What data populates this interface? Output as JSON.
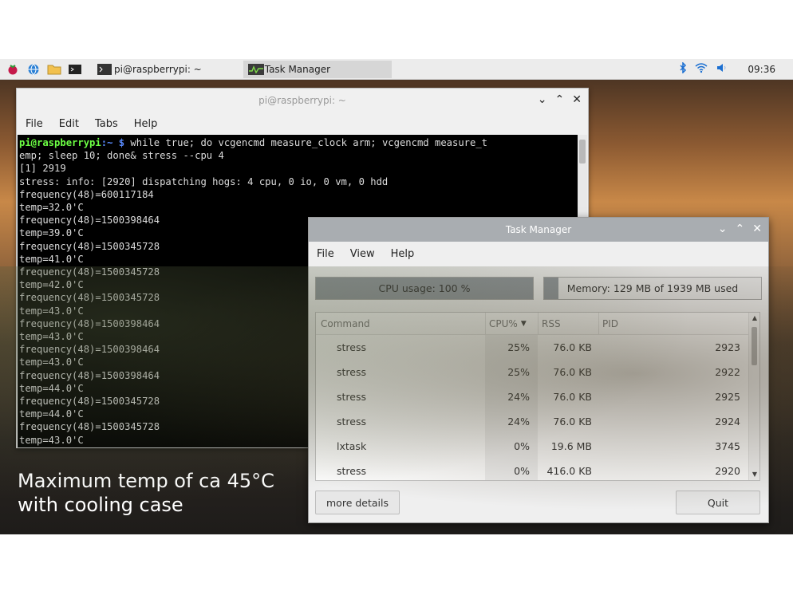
{
  "taskbar": {
    "window_buttons": [
      {
        "label": "pi@raspberrypi: ~",
        "active": false
      },
      {
        "label": "Task Manager",
        "active": true
      }
    ],
    "clock": "09:36"
  },
  "terminal": {
    "title": "pi@raspberrypi: ~",
    "menu": [
      "File",
      "Edit",
      "Tabs",
      "Help"
    ],
    "prompt_user": "pi@raspberrypi",
    "prompt_dir": ":~ $",
    "command": " while true; do vcgencmd measure_clock arm; vcgencmd measure_t",
    "lines": [
      "emp; sleep 10; done& stress --cpu 4",
      "[1] 2919",
      "stress: info: [2920] dispatching hogs: 4 cpu, 0 io, 0 vm, 0 hdd",
      "frequency(48)=600117184",
      "temp=32.0'C",
      "frequency(48)=1500398464",
      "temp=39.0'C",
      "frequency(48)=1500345728",
      "temp=41.0'C",
      "frequency(48)=1500345728",
      "temp=42.0'C",
      "frequency(48)=1500345728",
      "temp=43.0'C",
      "frequency(48)=1500398464",
      "temp=43.0'C",
      "frequency(48)=1500398464",
      "temp=43.0'C",
      "frequency(48)=1500398464",
      "temp=44.0'C",
      "frequency(48)=1500345728",
      "temp=44.0'C",
      "frequency(48)=1500345728",
      "temp=43.0'C"
    ]
  },
  "caption": {
    "line1": "Maximum temp of ca 45°C",
    "line2": "with cooling case"
  },
  "task_manager": {
    "title": "Task Manager",
    "menu": [
      "File",
      "View",
      "Help"
    ],
    "cpu_label": "CPU usage: 100 %",
    "cpu_fraction": 1.0,
    "memory_label": "Memory: 129 MB of 1939 MB used",
    "memory_fraction": 0.066,
    "columns": {
      "command": "Command",
      "cpu": "CPU%",
      "rss": "RSS",
      "pid": "PID"
    },
    "rows": [
      {
        "command": "stress",
        "cpu": "25%",
        "rss": "76.0 KB",
        "pid": "2923"
      },
      {
        "command": "stress",
        "cpu": "25%",
        "rss": "76.0 KB",
        "pid": "2922"
      },
      {
        "command": "stress",
        "cpu": "24%",
        "rss": "76.0 KB",
        "pid": "2925"
      },
      {
        "command": "stress",
        "cpu": "24%",
        "rss": "76.0 KB",
        "pid": "2924"
      },
      {
        "command": "lxtask",
        "cpu": "0%",
        "rss": "19.6 MB",
        "pid": "3745"
      },
      {
        "command": "stress",
        "cpu": "0%",
        "rss": "416.0 KB",
        "pid": "2920"
      }
    ],
    "more_details_label": "more details",
    "quit_label": "Quit"
  }
}
